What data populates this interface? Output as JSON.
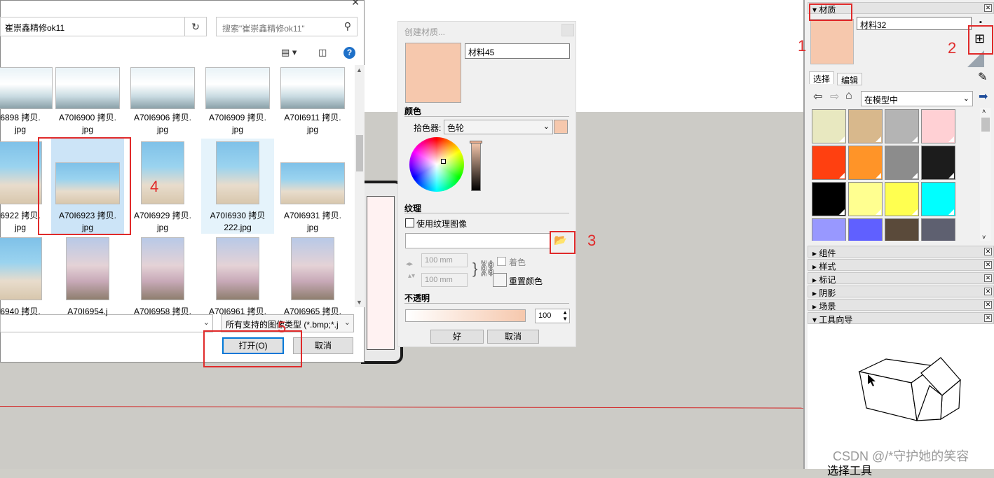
{
  "file_dialog": {
    "close_glyph": "✕",
    "address_path": "崔崇鑫精修ok11",
    "search_placeholder": "搜索\"崔崇鑫精修ok11\"",
    "files": [
      {
        "name_line1": "6898 拷贝.",
        "name_line2": "jpg",
        "thumb": "sky"
      },
      {
        "name_line1": "A70I6900 拷贝.",
        "name_line2": "jpg",
        "thumb": "sky"
      },
      {
        "name_line1": "A70I6906 拷贝.",
        "name_line2": "jpg",
        "thumb": "sky"
      },
      {
        "name_line1": "A70I6909 拷贝.",
        "name_line2": "jpg",
        "thumb": "sky"
      },
      {
        "name_line1": "A70I6911 拷贝.",
        "name_line2": "jpg",
        "thumb": "sky"
      },
      {
        "name_line1": "6922 拷贝.",
        "name_line2": "jpg",
        "thumb": "beach"
      },
      {
        "name_line1": "A70I6923 拷贝.",
        "name_line2": "jpg",
        "thumb": "beach",
        "selected": true
      },
      {
        "name_line1": "A70I6929 拷贝.",
        "name_line2": "jpg",
        "thumb": "beach"
      },
      {
        "name_line1": "A70I6930 拷贝",
        "name_line2": "222.jpg",
        "thumb": "beach",
        "hover": true
      },
      {
        "name_line1": "A70I6931 拷贝.",
        "name_line2": "jpg",
        "thumb": "beach"
      },
      {
        "name_line1": "6940 拷贝.",
        "name_line2": "",
        "thumb": "beach"
      },
      {
        "name_line1": "A70I6954.j",
        "name_line2": "",
        "thumb": "flowers"
      },
      {
        "name_line1": "A70I6958 拷贝.",
        "name_line2": "",
        "thumb": "flowers"
      },
      {
        "name_line1": "A70I6961 拷贝.",
        "name_line2": "",
        "thumb": "flowers"
      },
      {
        "name_line1": "A70I6965 拷贝.",
        "name_line2": "",
        "thumb": "flowers"
      }
    ],
    "file_type": "所有支持的图像类型 (*.bmp;*.j",
    "open_label": "打开(O)",
    "cancel_label": "取消"
  },
  "create_material": {
    "title": "创建材质...",
    "name_value": "材料45",
    "color_heading": "颜色",
    "picker_label": "拾色器:",
    "picker_value": "色轮",
    "texture_heading": "纹理",
    "use_texture_label": "使用纹理图像",
    "width_value": "100 mm",
    "height_value": "100 mm",
    "tint_label": "着色",
    "reset_color_label": "重置颜色",
    "opacity_heading": "不透明",
    "opacity_value": "100",
    "ok_label": "好",
    "cancel_label": "取消",
    "swatch_color": "#f6c8ad"
  },
  "tray": {
    "materials_header": "材质",
    "material_name": "材料32",
    "tab_select": "选择",
    "tab_edit": "编辑",
    "collection": "在模型中",
    "swatches": [
      "#e8e8c0",
      "#d8b88c",
      "#b4b4b4",
      "#ffd0d4",
      "#ff4010",
      "#ff9428",
      "#8c8c8c",
      "#1c1c1c",
      "#000000",
      "#ffff90",
      "#ffff50",
      "#00ffff",
      "#9898ff",
      "#6060ff",
      "#5a4a3a",
      "#5e6070"
    ],
    "panels": [
      "组件",
      "样式",
      "标记",
      "阴影",
      "场景",
      "工具向导"
    ],
    "help_caption": "选择工具"
  },
  "annotations": [
    "1",
    "2",
    "3",
    "4",
    "5"
  ],
  "watermark": "CSDN @/*守护她的笑容"
}
